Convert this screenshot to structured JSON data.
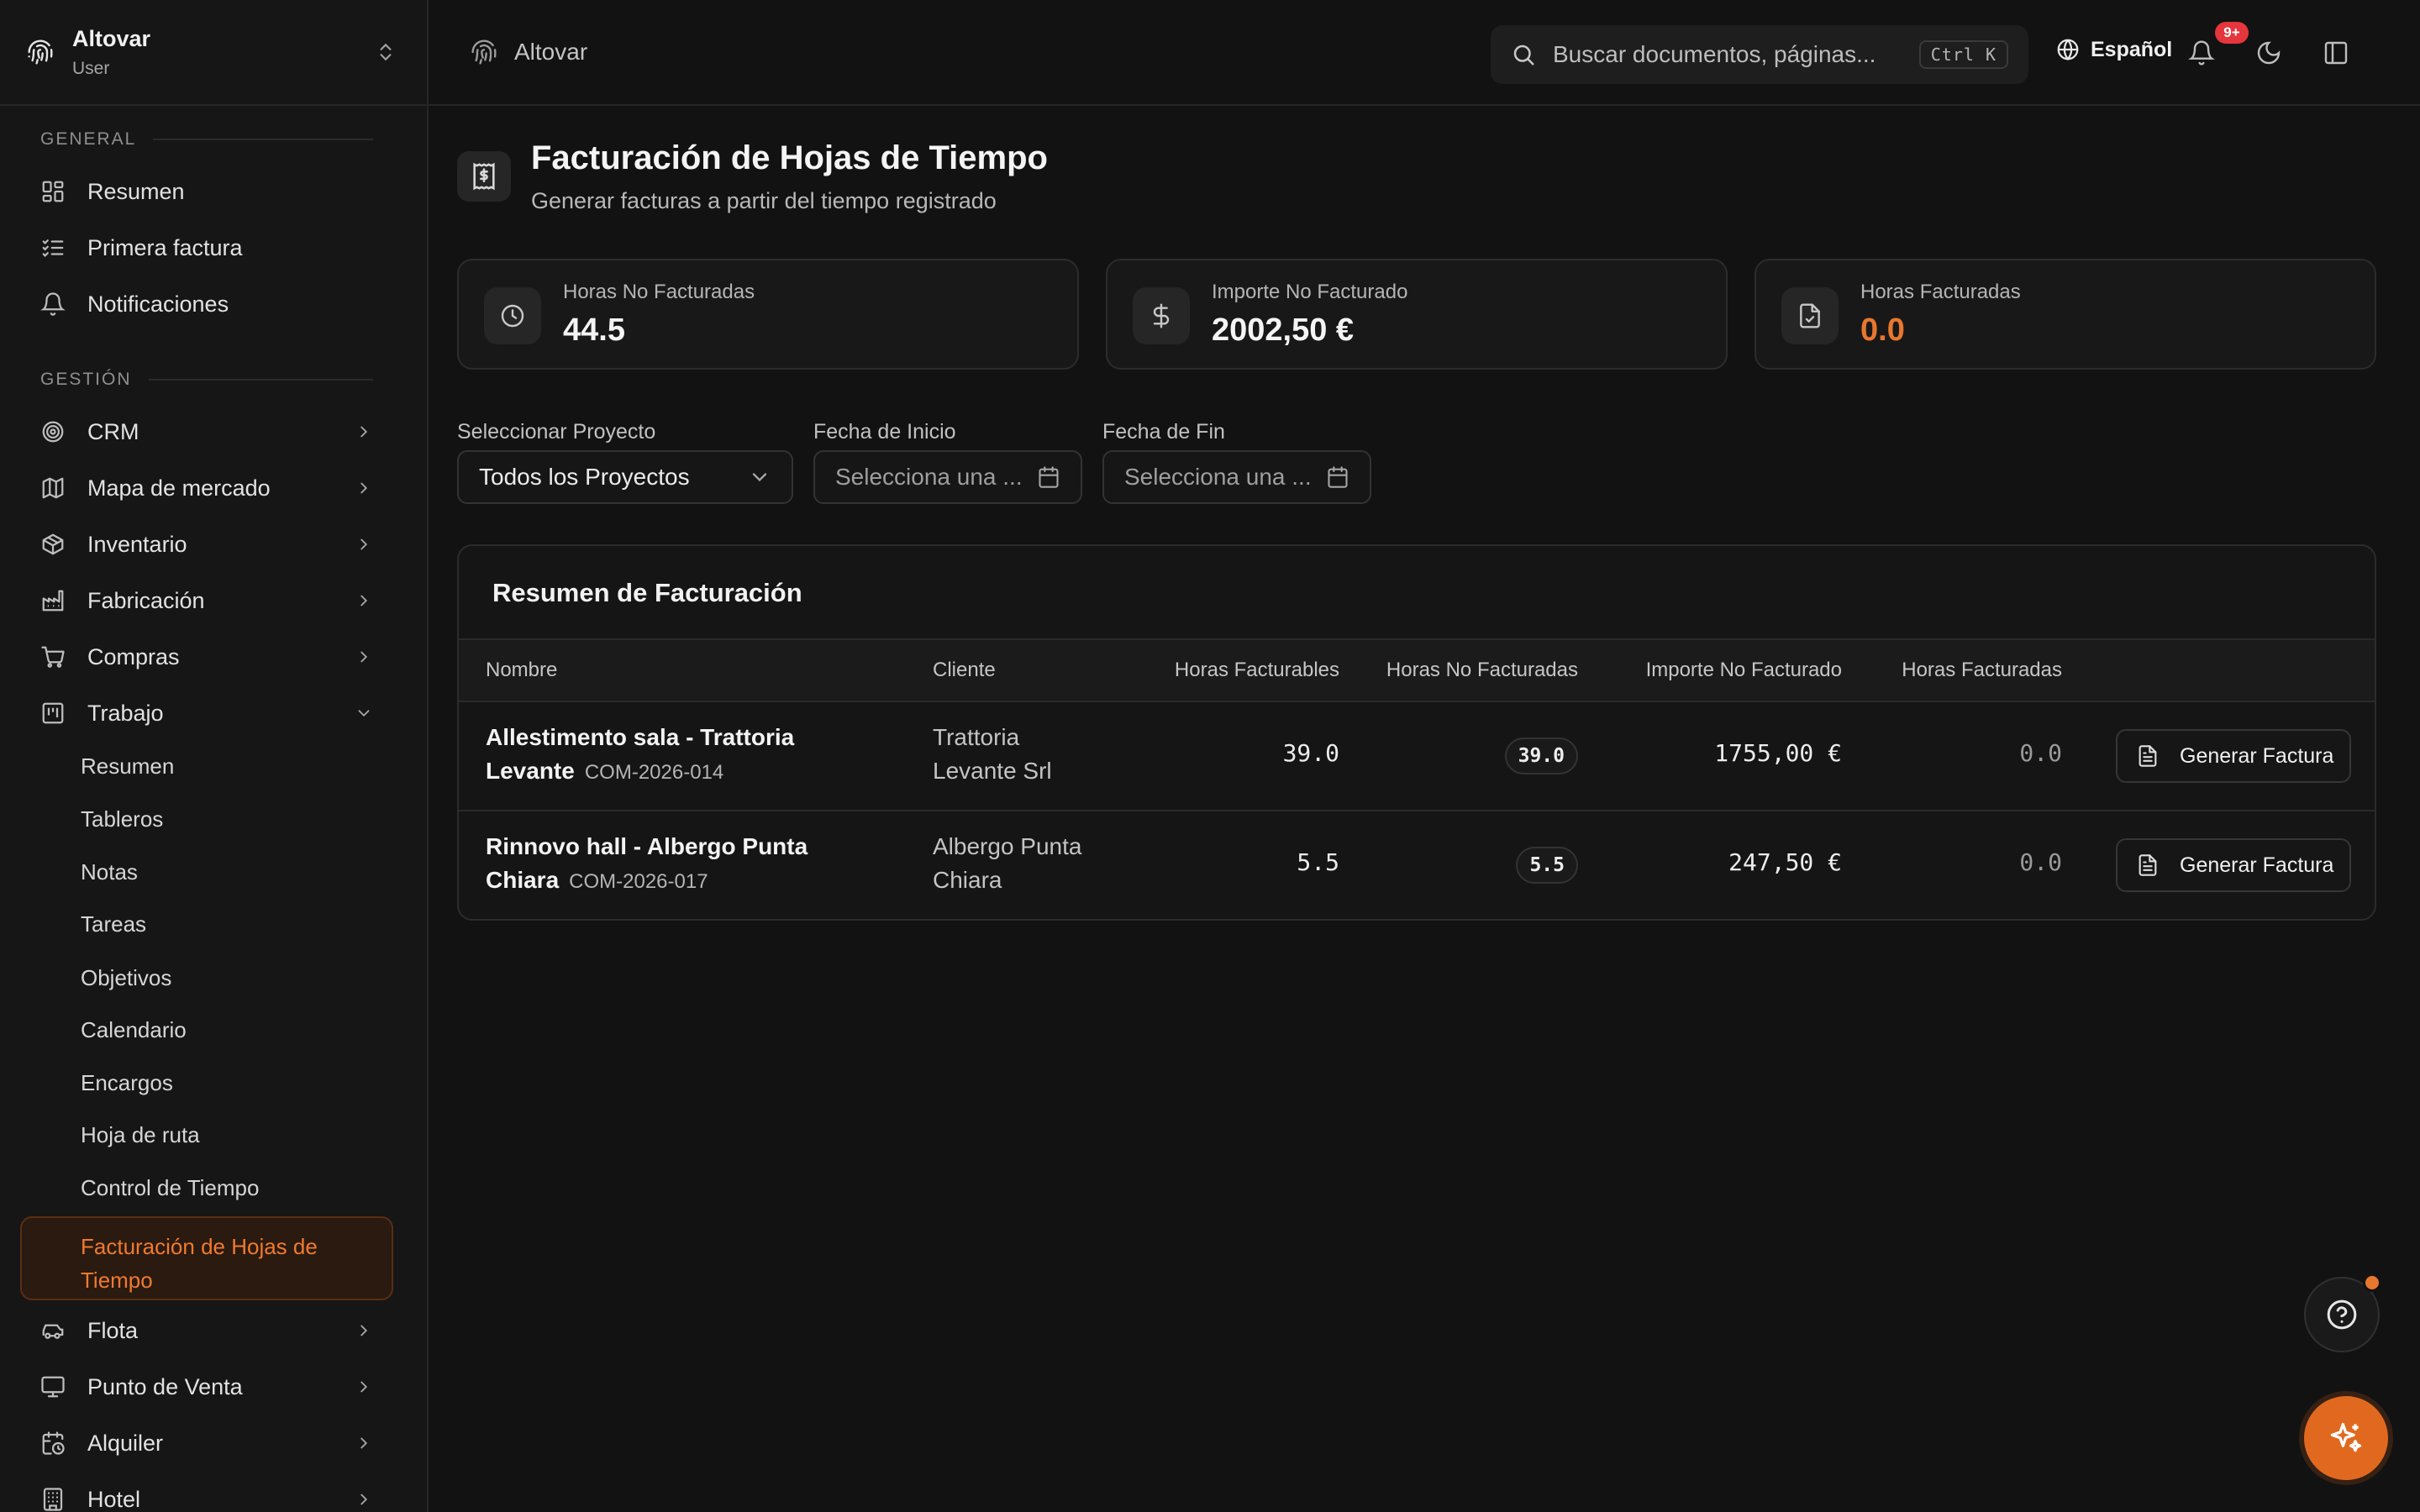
{
  "sidebar": {
    "app_name": "Altovar",
    "app_role": "User",
    "general_label": "GENERAL",
    "general_items": [
      {
        "label": "Resumen",
        "icon": "dashboard-icon"
      },
      {
        "label": "Primera factura",
        "icon": "list-check-icon"
      },
      {
        "label": "Notificaciones",
        "icon": "bell-icon"
      }
    ],
    "gestion_label": "GESTIÓN",
    "gestion_items": [
      {
        "label": "CRM",
        "icon": "target-icon"
      },
      {
        "label": "Mapa de mercado",
        "icon": "map-icon"
      },
      {
        "label": "Inventario",
        "icon": "box-icon"
      },
      {
        "label": "Fabricación",
        "icon": "factory-icon"
      },
      {
        "label": "Compras",
        "icon": "cart-icon"
      },
      {
        "label": "Trabajo",
        "icon": "kanban-icon"
      }
    ],
    "trabajo_sub": [
      "Resumen",
      "Tableros",
      "Notas",
      "Tareas",
      "Objetivos",
      "Calendario",
      "Encargos",
      "Hoja de ruta",
      "Control de Tiempo"
    ],
    "active_sub": "Facturación de Hojas de Tiempo",
    "bottom_items": [
      {
        "label": "Flota",
        "icon": "car-icon"
      },
      {
        "label": "Punto de Venta",
        "icon": "monitor-icon"
      },
      {
        "label": "Alquiler",
        "icon": "calendar-clock-icon"
      },
      {
        "label": "Hotel",
        "icon": "building-icon"
      }
    ]
  },
  "topbar": {
    "breadcrumb": "Altovar",
    "search_placeholder": "Buscar documentos, páginas...",
    "search_shortcut": "Ctrl K",
    "language": "Español",
    "notification_badge": "9+"
  },
  "page": {
    "title": "Facturación de Hojas de Tiempo",
    "subtitle": "Generar facturas a partir del tiempo registrado"
  },
  "stats": [
    {
      "label": "Horas No Facturadas",
      "value": "44.5"
    },
    {
      "label": "Importe No Facturado",
      "value": "2002,50 €"
    },
    {
      "label": "Horas Facturadas",
      "value": "0.0"
    }
  ],
  "filters": {
    "project_label": "Seleccionar Proyecto",
    "project_value": "Todos los Proyectos",
    "start_label": "Fecha de Inicio",
    "start_placeholder": "Selecciona una ...",
    "end_label": "Fecha de Fin",
    "end_placeholder": "Selecciona una ..."
  },
  "table": {
    "title": "Resumen de Facturación",
    "headers": [
      "Nombre",
      "Cliente",
      "Horas Facturables",
      "Horas No Facturadas",
      "Importe No Facturado",
      "Horas Facturadas"
    ],
    "rows": [
      {
        "name_line1": "Allestimento sala - Trattoria",
        "name_line2": "Levante",
        "code": "COM-2026-014",
        "client_line1": "Trattoria",
        "client_line2": "Levante Srl",
        "billable": "39.0",
        "unbilled": "39.0",
        "amount": "1755,00 €",
        "billed": "0.0",
        "action": "Generar Factura"
      },
      {
        "name_line1": "Rinnovo hall - Albergo Punta",
        "name_line2": "Chiara",
        "code": "COM-2026-017",
        "client_line1": "Albergo Punta",
        "client_line2": "Chiara",
        "billable": "5.5",
        "unbilled": "5.5",
        "amount": "247,50 €",
        "billed": "0.0",
        "action": "Generar Factura"
      }
    ]
  },
  "colors": {
    "accent": "#e8772e",
    "background": "#121212",
    "badge": "#e5353d"
  }
}
